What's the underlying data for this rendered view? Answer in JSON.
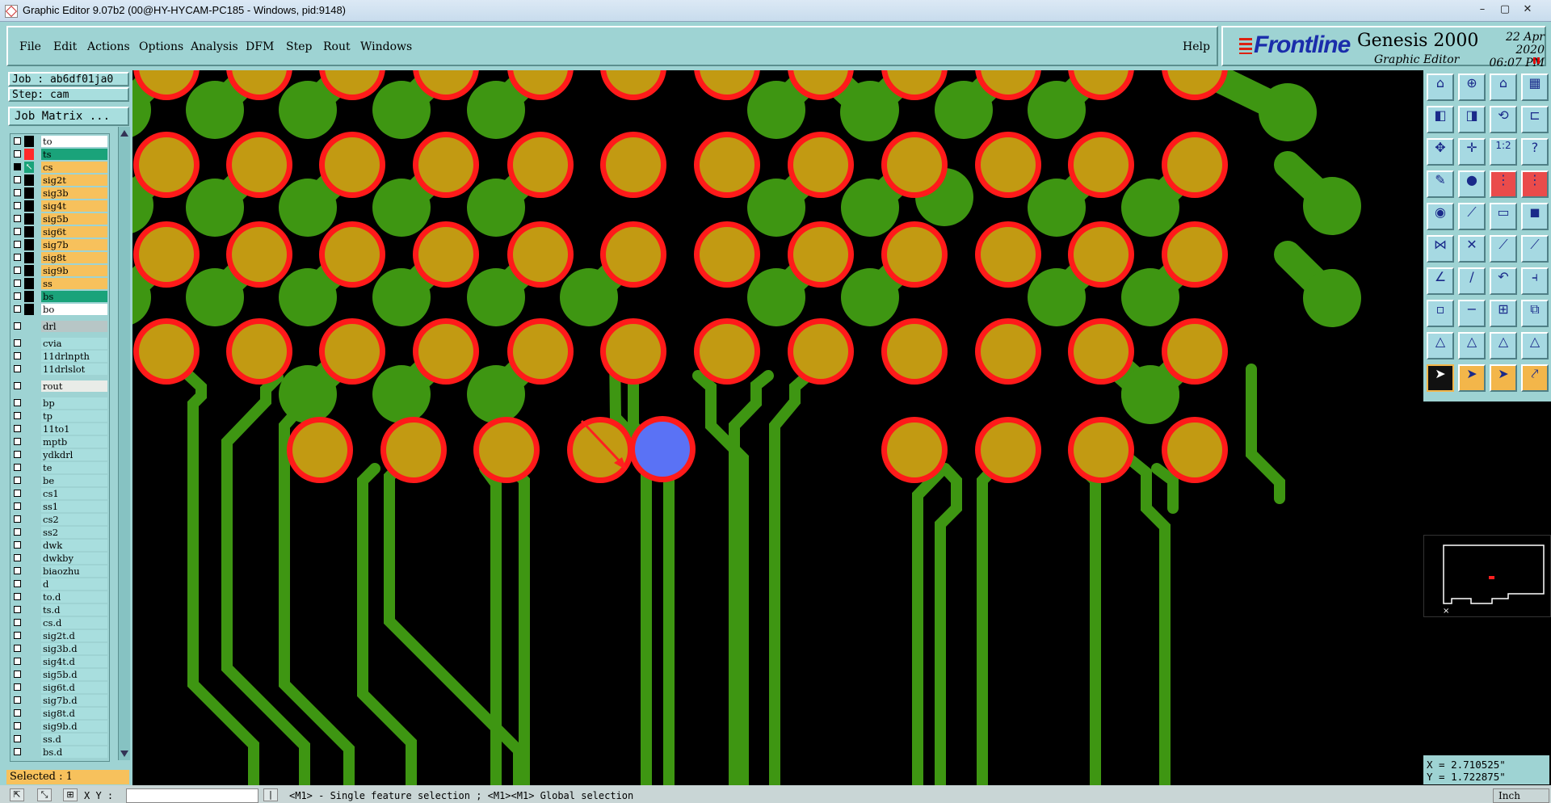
{
  "window": {
    "title": "Graphic Editor 9.07b2 (00@HY-HYCAM-PC185 - Windows, pid:9148)",
    "controls": [
      "–",
      "▢",
      "✕"
    ]
  },
  "menu": {
    "items": [
      "File",
      "Edit",
      "Actions",
      "Options",
      "Analysis",
      "DFM",
      "Step",
      "Rout",
      "Windows"
    ],
    "help": "Help"
  },
  "brand": {
    "logo": "Frontline",
    "product": "Genesis 2000",
    "subtitle": "Graphic Editor",
    "date": "22 Apr 2020",
    "time": "06:07 PM"
  },
  "job": {
    "label": "Job : ab6df01ja0",
    "step": "Step: cam",
    "matrix_button": "Job Matrix ..."
  },
  "layers": [
    {
      "name": "to",
      "bg": "#ffffff",
      "mark": "#000000",
      "checked": false
    },
    {
      "name": "ts",
      "bg": "#1aa37a",
      "mark": "#ff2a2a",
      "checked": false
    },
    {
      "name": "cs",
      "bg": "#f7c15c",
      "mark": "#1aa37a",
      "checked": true,
      "arrow": true
    },
    {
      "name": "sig2t",
      "bg": "#f7c15c",
      "mark": "#000000",
      "checked": false
    },
    {
      "name": "sig3b",
      "bg": "#f7c15c",
      "mark": "#000000",
      "checked": false
    },
    {
      "name": "sig4t",
      "bg": "#f7c15c",
      "mark": "#000000",
      "checked": false
    },
    {
      "name": "sig5b",
      "bg": "#f7c15c",
      "mark": "#000000",
      "checked": false
    },
    {
      "name": "sig6t",
      "bg": "#f7c15c",
      "mark": "#000000",
      "checked": false
    },
    {
      "name": "sig7b",
      "bg": "#f7c15c",
      "mark": "#000000",
      "checked": false
    },
    {
      "name": "sig8t",
      "bg": "#f7c15c",
      "mark": "#000000",
      "checked": false
    },
    {
      "name": "sig9b",
      "bg": "#f7c15c",
      "mark": "#000000",
      "checked": false
    },
    {
      "name": "ss",
      "bg": "#f7c15c",
      "mark": "#000000",
      "checked": false
    },
    {
      "name": "bs",
      "bg": "#1aa37a",
      "mark": "#000000",
      "checked": false
    },
    {
      "name": "bo",
      "bg": "#ffffff",
      "mark": "#000000",
      "checked": false
    },
    {
      "name": "drl",
      "bg": "#b7c6c6",
      "mark": "",
      "checked": false,
      "gap": true
    },
    {
      "name": "cvia",
      "bg": "#a8dede",
      "mark": "",
      "checked": false,
      "gap": true
    },
    {
      "name": "11drlnpth",
      "bg": "#a8dede",
      "mark": "",
      "checked": false
    },
    {
      "name": "11drlslot",
      "bg": "#a8dede",
      "mark": "",
      "checked": false
    },
    {
      "name": "rout",
      "bg": "#e9ece8",
      "mark": "",
      "checked": false,
      "gap": true
    },
    {
      "name": "bp",
      "bg": "#a8dede",
      "mark": "",
      "checked": false,
      "gap": true
    },
    {
      "name": "tp",
      "bg": "#a8dede",
      "mark": "",
      "checked": false
    },
    {
      "name": "11to1",
      "bg": "#a8dede",
      "mark": "",
      "checked": false
    },
    {
      "name": "mptb",
      "bg": "#a8dede",
      "mark": "",
      "checked": false
    },
    {
      "name": "ydkdrl",
      "bg": "#a8dede",
      "mark": "",
      "checked": false
    },
    {
      "name": "te",
      "bg": "#a8dede",
      "mark": "",
      "checked": false
    },
    {
      "name": "be",
      "bg": "#a8dede",
      "mark": "",
      "checked": false
    },
    {
      "name": "cs1",
      "bg": "#a8dede",
      "mark": "",
      "checked": false
    },
    {
      "name": "ss1",
      "bg": "#a8dede",
      "mark": "",
      "checked": false
    },
    {
      "name": "cs2",
      "bg": "#a8dede",
      "mark": "",
      "checked": false
    },
    {
      "name": "ss2",
      "bg": "#a8dede",
      "mark": "",
      "checked": false
    },
    {
      "name": "dwk",
      "bg": "#a8dede",
      "mark": "",
      "checked": false
    },
    {
      "name": "dwkby",
      "bg": "#a8dede",
      "mark": "",
      "checked": false
    },
    {
      "name": "biaozhu",
      "bg": "#a8dede",
      "mark": "",
      "checked": false
    },
    {
      "name": "d",
      "bg": "#a8dede",
      "mark": "",
      "checked": false
    },
    {
      "name": "to.d",
      "bg": "#a8dede",
      "mark": "",
      "checked": false
    },
    {
      "name": "ts.d",
      "bg": "#a8dede",
      "mark": "",
      "checked": false
    },
    {
      "name": "cs.d",
      "bg": "#a8dede",
      "mark": "",
      "checked": false
    },
    {
      "name": "sig2t.d",
      "bg": "#a8dede",
      "mark": "",
      "checked": false
    },
    {
      "name": "sig3b.d",
      "bg": "#a8dede",
      "mark": "",
      "checked": false
    },
    {
      "name": "sig4t.d",
      "bg": "#a8dede",
      "mark": "",
      "checked": false
    },
    {
      "name": "sig5b.d",
      "bg": "#a8dede",
      "mark": "",
      "checked": false
    },
    {
      "name": "sig6t.d",
      "bg": "#a8dede",
      "mark": "",
      "checked": false
    },
    {
      "name": "sig7b.d",
      "bg": "#a8dede",
      "mark": "",
      "checked": false
    },
    {
      "name": "sig8t.d",
      "bg": "#a8dede",
      "mark": "",
      "checked": false
    },
    {
      "name": "sig9b.d",
      "bg": "#a8dede",
      "mark": "",
      "checked": false
    },
    {
      "name": "ss.d",
      "bg": "#a8dede",
      "mark": "",
      "checked": false
    },
    {
      "name": "bs.d",
      "bg": "#a8dede",
      "mark": "",
      "checked": false
    }
  ],
  "selected": "Selected : 1",
  "tools": [
    {
      "icon": "zoom-home-icon",
      "glyph": "⌂",
      "style": ""
    },
    {
      "icon": "zoom-in-icon",
      "glyph": "⊕",
      "style": ""
    },
    {
      "icon": "home-icon",
      "glyph": "⌂",
      "style": ""
    },
    {
      "icon": "layout-icon",
      "glyph": "▦",
      "style": ""
    },
    {
      "icon": "pan-left-icon",
      "glyph": "◧",
      "style": ""
    },
    {
      "icon": "pan-right-icon",
      "glyph": "◨",
      "style": ""
    },
    {
      "icon": "redraw-icon",
      "glyph": "⟲",
      "style": ""
    },
    {
      "icon": "snap-icon",
      "glyph": "⊏",
      "style": ""
    },
    {
      "icon": "fit-icon",
      "glyph": "✥",
      "style": ""
    },
    {
      "icon": "center-icon",
      "glyph": "✛",
      "style": ""
    },
    {
      "icon": "ratio-icon",
      "glyph": "1:2",
      "style": ""
    },
    {
      "icon": "help-icon",
      "glyph": "?",
      "style": ""
    },
    {
      "icon": "measure-icon",
      "glyph": "✎",
      "style": ""
    },
    {
      "icon": "pad-icon",
      "glyph": "●",
      "style": ""
    },
    {
      "icon": "net-icon",
      "glyph": "⋮",
      "style": "red"
    },
    {
      "icon": "net2-icon",
      "glyph": "⋮",
      "style": "red"
    },
    {
      "icon": "add-pad-icon",
      "glyph": "◉",
      "style": ""
    },
    {
      "icon": "add-line-icon",
      "glyph": "⟋",
      "style": ""
    },
    {
      "icon": "add-text-icon",
      "glyph": "▭",
      "style": ""
    },
    {
      "icon": "add-surface-icon",
      "glyph": "◼",
      "style": ""
    },
    {
      "icon": "node-icon",
      "glyph": "⋈",
      "style": ""
    },
    {
      "icon": "cross-icon",
      "glyph": "✕",
      "style": ""
    },
    {
      "icon": "connect-icon",
      "glyph": "⟋",
      "style": ""
    },
    {
      "icon": "dot-line-icon",
      "glyph": "⟋",
      "style": ""
    },
    {
      "icon": "angle-icon",
      "glyph": "∠",
      "style": ""
    },
    {
      "icon": "slash-icon",
      "glyph": "/",
      "style": ""
    },
    {
      "icon": "arc-icon",
      "glyph": "↶",
      "style": ""
    },
    {
      "icon": "fork-icon",
      "glyph": "⫞",
      "style": ""
    },
    {
      "icon": "pad-move-icon",
      "glyph": "▫",
      "style": ""
    },
    {
      "icon": "minus-icon",
      "glyph": "−",
      "style": ""
    },
    {
      "icon": "align-icon",
      "glyph": "⊞",
      "style": ""
    },
    {
      "icon": "copy-icon",
      "glyph": "⧉",
      "style": ""
    },
    {
      "icon": "tri1-icon",
      "glyph": "△",
      "style": ""
    },
    {
      "icon": "tri2-icon",
      "glyph": "△",
      "style": ""
    },
    {
      "icon": "tri3-icon",
      "glyph": "△",
      "style": ""
    },
    {
      "icon": "tri4-icon",
      "glyph": "△",
      "style": ""
    },
    {
      "icon": "pointer-icon",
      "glyph": "➤",
      "style": "black"
    },
    {
      "icon": "pointer2-icon",
      "glyph": "➤",
      "style": "yellow"
    },
    {
      "icon": "pointer3-icon",
      "glyph": "➤",
      "style": "yellow"
    },
    {
      "icon": "pointer4-icon",
      "glyph": "⤤",
      "style": "yellow"
    }
  ],
  "coords": {
    "x": "X = 2.710525\"",
    "y": "Y = 1.722875\""
  },
  "statusbar": {
    "xy_label": "X Y :",
    "message": "<M1> - Single feature selection ; <M1><M1> Global selection",
    "unit": "Inch"
  }
}
